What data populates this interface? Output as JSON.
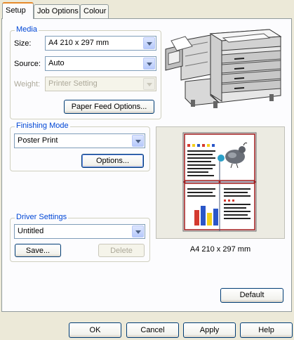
{
  "tabs": [
    "Setup",
    "Job Options",
    "Colour"
  ],
  "media": {
    "legend": "Media",
    "size_label": "Size:",
    "size_value": "A4 210 x 297 mm",
    "source_label": "Source:",
    "source_value": "Auto",
    "weight_label": "Weight:",
    "weight_value": "Printer Setting",
    "paper_feed_button": "Paper Feed Options..."
  },
  "finishing": {
    "legend": "Finishing Mode",
    "value": "Poster Print",
    "options_button": "Options..."
  },
  "driver": {
    "legend": "Driver Settings",
    "value": "Untitled",
    "save_button": "Save...",
    "delete_button": "Delete"
  },
  "preview": {
    "caption": "A4 210 x 297 mm"
  },
  "default_button": "Default",
  "footer": {
    "ok": "OK",
    "cancel": "Cancel",
    "apply": "Apply",
    "help": "Help"
  },
  "colors": {
    "accent": "#0046d5",
    "tab_highlight": "#e68b2c",
    "poster_border": "#a01818"
  }
}
